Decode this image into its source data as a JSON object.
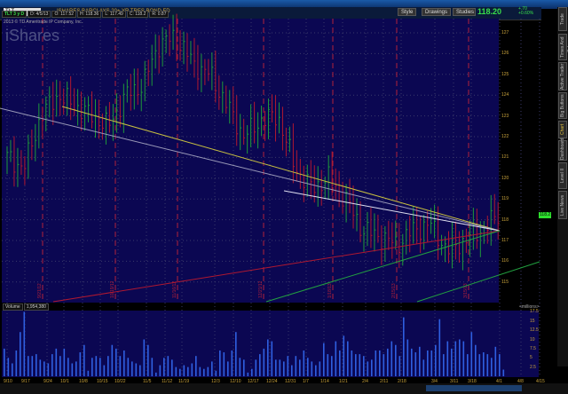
{
  "header": {
    "symbol": "TLT",
    "title": "ISHARES BARCLAYS 20+ YR TRES BOND FD",
    "last": "118.20",
    "change": "+.70",
    "change_pct": "+0.60%",
    "buttons": [
      "Style",
      "Drawings",
      "Studies"
    ]
  },
  "quote": {
    "symbol_period": "TLT 3 y D",
    "date": "D: 4/5/13",
    "open": "O: 117.52",
    "high": "H: 118.36",
    "low": "L: 117.49",
    "close": "C: 118.2",
    "range": "R: 0.87"
  },
  "copyright": "2013 © TD Ameritrade IP Company, Inc.",
  "logo": "iShares",
  "sidebar_tabs": [
    "Trade",
    "Times And Sales",
    "Active Trader",
    "Big Buttons",
    "Chart",
    "Dashboard",
    "Level II",
    "Live News"
  ],
  "active_tab": "Chart",
  "price_axis": {
    "ticks": [
      "127",
      "126",
      "125",
      "124",
      "123",
      "122",
      "121",
      "120",
      "119",
      "118",
      "117",
      "116",
      "115"
    ],
    "last_label": "118.2"
  },
  "volume": {
    "label": "Volume",
    "value": "1,954,380",
    "unit": "<millions>",
    "ticks": [
      "17.5",
      "15",
      "12.5",
      "10",
      "7.5",
      "5",
      "2.5"
    ]
  },
  "expirations": [
    "9/21/12",
    "10/19/12",
    "11/16/12",
    "12/21/12",
    "1/18/13",
    "2/15/13",
    "3/15/13"
  ],
  "chart_data": {
    "type": "bar",
    "title": "TLT daily OHLC",
    "x_ticks": [
      "9/10",
      "9/17",
      "9/24",
      "10/1",
      "10/8",
      "10/15",
      "10/22",
      "11/5",
      "11/12",
      "11/19",
      "12/3",
      "12/10",
      "12/17",
      "12/24",
      "12/31",
      "1/7",
      "1/14",
      "1/21",
      "2/4",
      "2/11",
      "2/18",
      "3/4",
      "3/11",
      "3/18",
      "4/1",
      "4/8",
      "4/15"
    ],
    "weekly_closes": [
      121,
      120.5,
      123,
      124,
      123.5,
      123,
      122.5,
      124,
      124.5,
      126.5,
      126.8,
      125.5,
      125,
      123.5,
      122,
      122.8,
      123,
      120.5,
      119.5,
      120,
      119,
      117.5,
      117.2,
      116.8,
      117.5,
      117.8,
      116.5,
      117,
      117.5,
      118.2
    ],
    "volume_millions": [
      7.5,
      5,
      3.5,
      7,
      12,
      17.5,
      5.5,
      5.5,
      6,
      4.5,
      4,
      3.5,
      6,
      7.5,
      5.5,
      7.5,
      5,
      3.5,
      4,
      6.5,
      8.5,
      1.5,
      5,
      5.5,
      5,
      3,
      5.5,
      8.5,
      7.5,
      5.5,
      7,
      5,
      4,
      3.5,
      3,
      10,
      8.5,
      5,
      1,
      3,
      5,
      5.5,
      4.5,
      2.5,
      2,
      3,
      2.5,
      3.5,
      5.5,
      2.5,
      2,
      2.5,
      4,
      1.5,
      7,
      6.5,
      4,
      7,
      12,
      5,
      4.5,
      1,
      2,
      4.5,
      6,
      7.5,
      10,
      9.5,
      4.5,
      4.5,
      4,
      5.5,
      3,
      5.5,
      4.5,
      7,
      5,
      4,
      3,
      4,
      9,
      6,
      5.5,
      9.5,
      7,
      11,
      9.5,
      7,
      6,
      6,
      5.5,
      4,
      4.5,
      7,
      7,
      6,
      7.5,
      9.5,
      8.5,
      5.5,
      16,
      10,
      7.5,
      6.5,
      8,
      4.5,
      7,
      7,
      8.5,
      15.5,
      6,
      9.5,
      7.5,
      9.5,
      10,
      9.5,
      6,
      12,
      8.5,
      6,
      6.5,
      6,
      5,
      8,
      6,
      1.8
    ],
    "ylim": [
      114.5,
      127.5
    ],
    "volume_ylim": [
      0,
      18
    ]
  }
}
